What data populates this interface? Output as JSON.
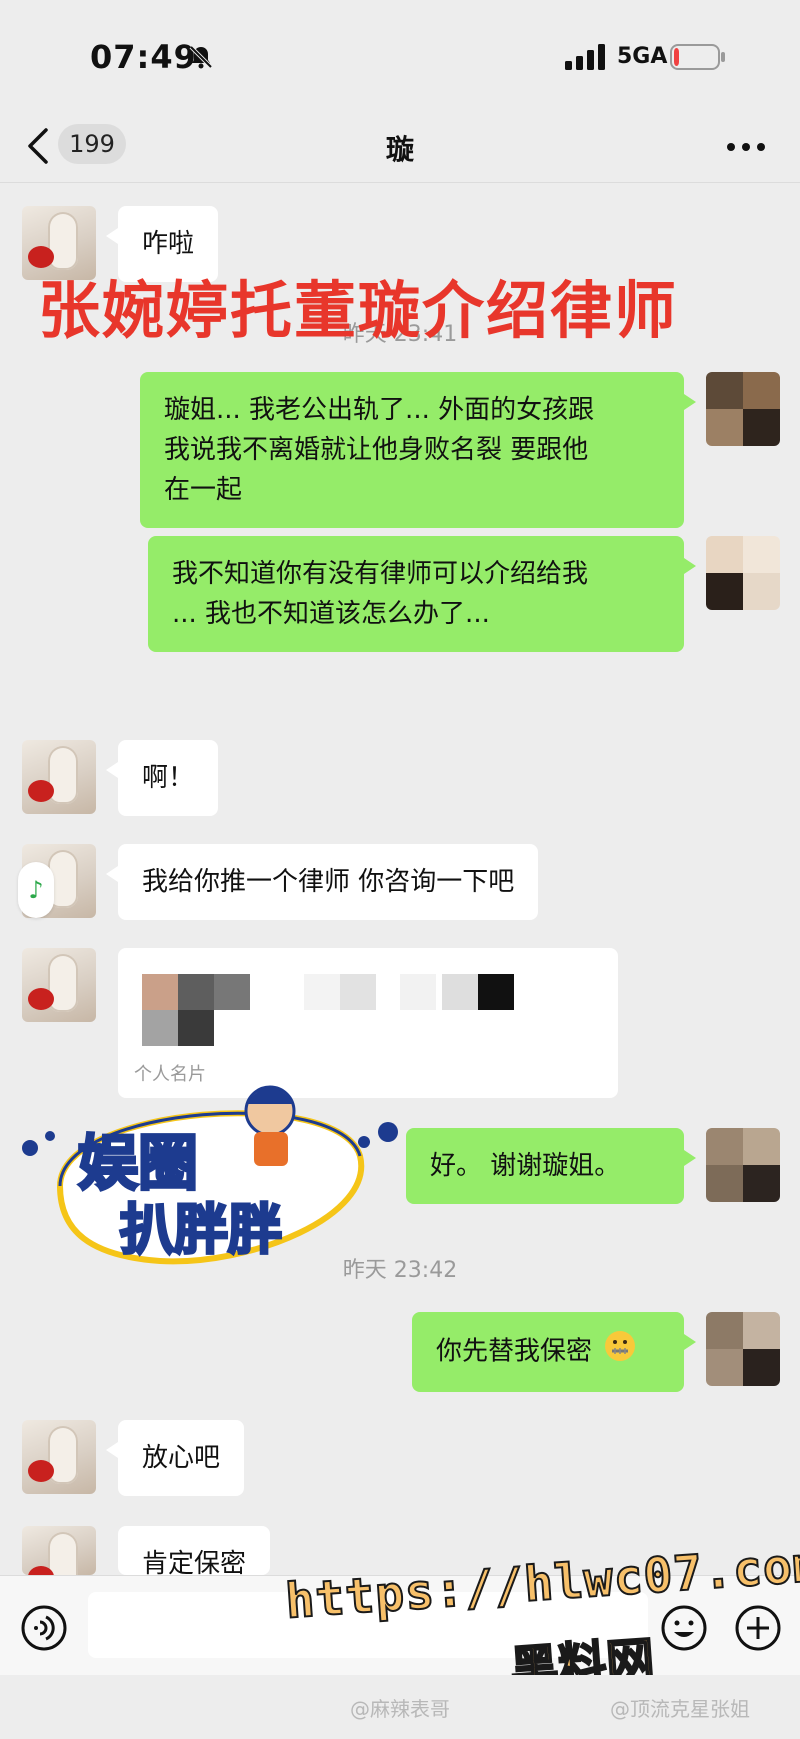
{
  "status_bar": {
    "time": "07:49",
    "network": "5GA",
    "battery_level": 0.12,
    "battery_color": "#f04141"
  },
  "nav": {
    "unread_count": "199",
    "title": "璇"
  },
  "overlay_title": "张婉婷托董璇介绍律师",
  "messages": [
    {
      "side": "left",
      "text": "咋啦"
    },
    {
      "side": "time",
      "text": "昨天 23:41"
    },
    {
      "side": "right",
      "text_lines": [
        "璇姐... 我老公出轨了... 外面的女孩跟",
        "我说我不离婚就让他身败名裂 要跟他",
        "在一起"
      ]
    },
    {
      "side": "right",
      "text_lines": [
        "我不知道你有没有律师可以介绍给我",
        "... 我也不知道该怎么办了..."
      ]
    },
    {
      "side": "left",
      "text": "啊！"
    },
    {
      "side": "left",
      "text": "我给你推一个律师 你咨询一下吧"
    },
    {
      "side": "left",
      "type": "contact-card",
      "card_label": "个人名片"
    },
    {
      "side": "right",
      "text": "好。 谢谢璇姐。"
    },
    {
      "side": "time",
      "text": "昨天 23:42"
    },
    {
      "side": "right",
      "text": "你先替我保密",
      "emoji": "zipper-mouth"
    },
    {
      "side": "left",
      "text": "放心吧"
    },
    {
      "side": "left",
      "text": "肯定保密"
    }
  ],
  "watermark": {
    "logo_line1": "娱圈",
    "logo_line2": "扒胖胖",
    "url": "https://hlwc07.com",
    "site": "黑料网"
  },
  "footer": {
    "credit1": "@麻辣表哥",
    "credit2": "@顶流克星张姐"
  },
  "colors": {
    "bubble_right": "#95ec69",
    "bubble_left": "#ffffff",
    "overlay_title": "#e8362b",
    "background": "#ededed"
  }
}
